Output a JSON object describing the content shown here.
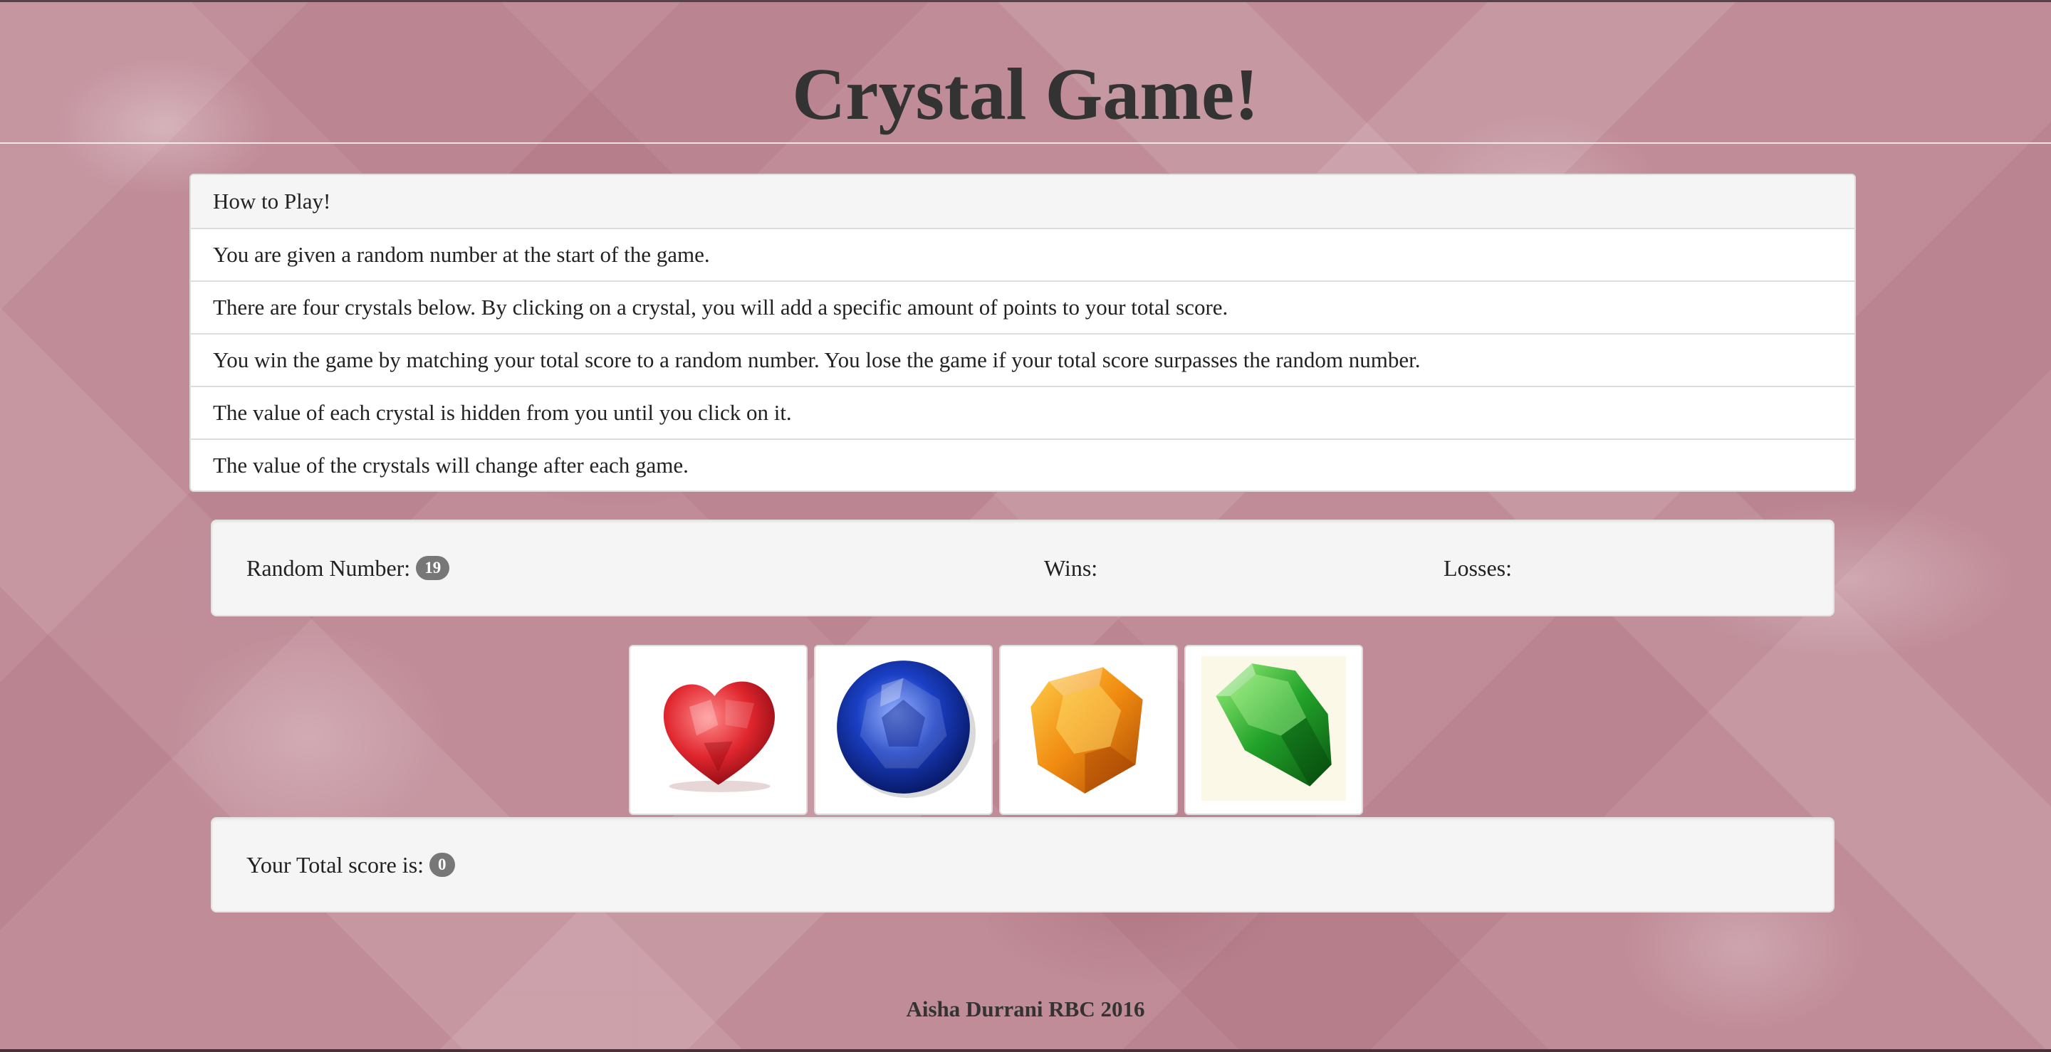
{
  "header": {
    "title": "Crystal Game!"
  },
  "instructions": {
    "heading": "How to Play!",
    "items": [
      "You are given a random number at the start of the game.",
      "There are four crystals below. By clicking on a crystal, you will add a specific amount of points to your total score.",
      "You win the game by matching your total score to a random number. You lose the game if your total score surpasses the random number.",
      "The value of each crystal is hidden from you until you click on it.",
      "The value of the crystals will change after each game."
    ]
  },
  "stats": {
    "random_label": "Random Number:",
    "random_value": "19",
    "wins_label": "Wins:",
    "losses_label": "Losses:"
  },
  "crystals": [
    {
      "name": "red-heart-crystal",
      "color": "#e0262e"
    },
    {
      "name": "blue-round-crystal",
      "color": "#1a3fc4"
    },
    {
      "name": "orange-crystal",
      "color": "#f08a10"
    },
    {
      "name": "green-crystal",
      "color": "#22a32a"
    }
  ],
  "score": {
    "label": "Your Total score is:",
    "value": "0"
  },
  "footer": {
    "text": "Aisha Durrani RBC 2016"
  },
  "colors": {
    "background": "#c08c98",
    "badge": "#777777",
    "well": "#f5f5f5"
  }
}
